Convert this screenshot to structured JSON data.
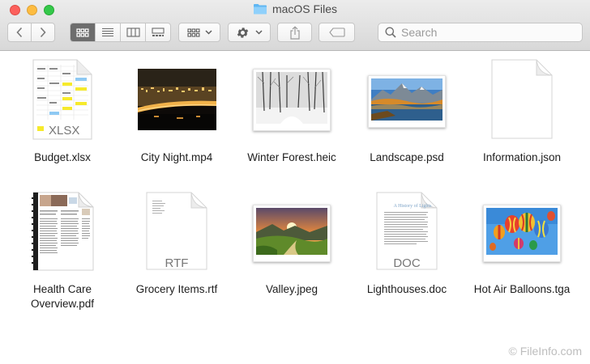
{
  "window": {
    "title": "macOS Files"
  },
  "toolbar": {
    "back_icon": "chevron-left-icon",
    "forward_icon": "chevron-right-icon",
    "views": [
      "icon-view-icon",
      "list-view-icon",
      "column-view-icon",
      "gallery-view-icon"
    ],
    "active_view": 0,
    "arrange_icon": "arrange-grid-icon",
    "action_icon": "gear-icon",
    "share_icon": "share-icon",
    "tag_icon": "tag-icon"
  },
  "search": {
    "placeholder": "Search",
    "value": ""
  },
  "files": [
    {
      "name": "Budget.xlsx",
      "badge": "XLSX"
    },
    {
      "name": "City Night.mp4"
    },
    {
      "name": "Winter Forest.heic"
    },
    {
      "name": "Landscape.psd"
    },
    {
      "name": "Information.json"
    },
    {
      "name": "Health Care Overview.pdf"
    },
    {
      "name": "Grocery Items.rtf",
      "badge": "RTF"
    },
    {
      "name": "Valley.jpeg"
    },
    {
      "name": "Lighthouses.doc",
      "badge": "DOC",
      "doc_heading": "A History of Lights"
    },
    {
      "name": "Hot Air Balloons.tga"
    }
  ],
  "watermark": "© FileInfo.com",
  "colors": {
    "accent_folder": "#5fb6f2",
    "close": "#fc605c",
    "minimize": "#fdbc40",
    "zoom": "#34c84a"
  }
}
